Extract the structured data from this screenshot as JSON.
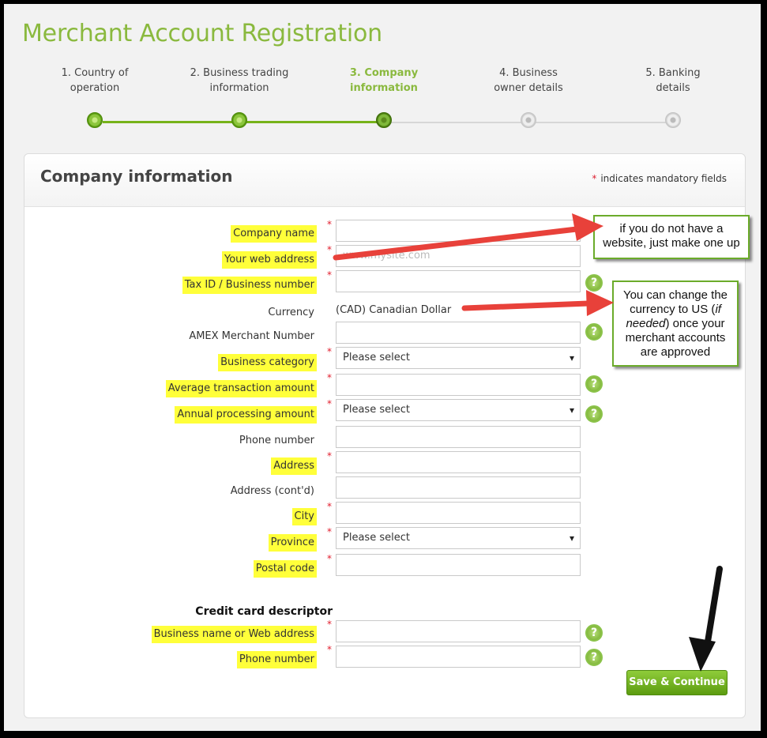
{
  "page": {
    "title": "Merchant Account Registration"
  },
  "steps": [
    {
      "line1": "1. Country of",
      "line2": "operation",
      "state": "done"
    },
    {
      "line1": "2. Business trading",
      "line2": "information",
      "state": "done"
    },
    {
      "line1": "3. Company",
      "line2": "information",
      "state": "active"
    },
    {
      "line1": "4. Business",
      "line2": "owner details",
      "state": "todo"
    },
    {
      "line1": "5. Banking",
      "line2": "details",
      "state": "todo"
    }
  ],
  "panel": {
    "title": "Company information",
    "mandatory_star": "*",
    "mandatory_note": "indicates mandatory fields"
  },
  "form": {
    "company_name": {
      "label": "Company name",
      "value": ""
    },
    "web_address": {
      "label": "Your web address",
      "placeholder": "www.mysite.com"
    },
    "tax_id": {
      "label": "Tax ID / Business number",
      "value": ""
    },
    "currency": {
      "label": "Currency",
      "value": "(CAD) Canadian Dollar"
    },
    "amex": {
      "label": "AMEX Merchant Number",
      "value": ""
    },
    "business_category": {
      "label": "Business category",
      "value": "Please select"
    },
    "avg_transaction": {
      "label": "Average transaction amount",
      "value": ""
    },
    "annual_processing": {
      "label": "Annual processing amount",
      "value": "Please select"
    },
    "phone": {
      "label": "Phone number",
      "value": ""
    },
    "address": {
      "label": "Address",
      "value": ""
    },
    "address2": {
      "label": "Address (cont'd)",
      "value": ""
    },
    "city": {
      "label": "City",
      "value": ""
    },
    "province": {
      "label": "Province",
      "value": "Please select"
    },
    "postal": {
      "label": "Postal code",
      "value": ""
    },
    "descriptor_heading": "Credit card descriptor",
    "descriptor_name": {
      "label": "Business name or Web address",
      "value": ""
    },
    "descriptor_phone": {
      "label": "Phone number",
      "value": ""
    },
    "help_glyph": "?",
    "required_star": "*"
  },
  "buttons": {
    "save": "Save & Continue"
  },
  "annotations": {
    "website_note": "if you do not have a website, just make one up",
    "currency_note_a": "You can change the currency to US (",
    "currency_note_em": "if needed",
    "currency_note_b": ") once your merchant accounts are approved"
  },
  "colors": {
    "accent": "#8ab93e",
    "highlight": "#ffff3a",
    "required": "#e2202f",
    "arrow_red": "#e8413a"
  }
}
